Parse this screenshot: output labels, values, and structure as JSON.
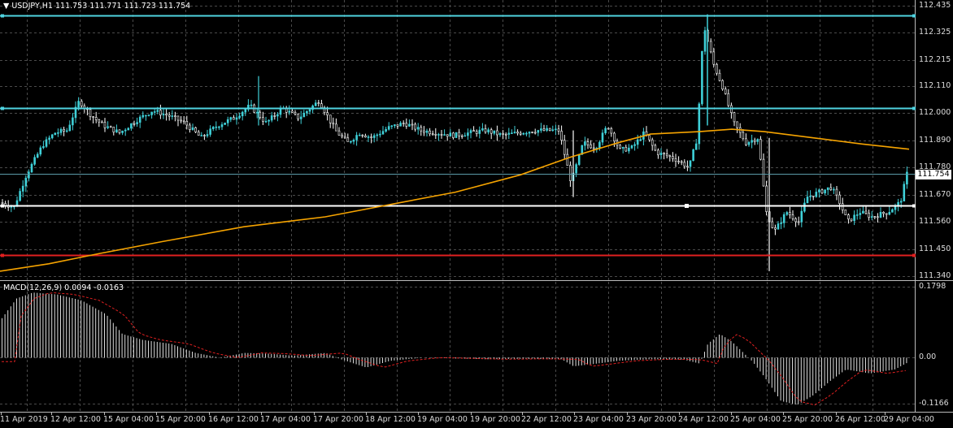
{
  "chart_data": [
    {
      "type": "candlestick",
      "symbol": "USDJPY,H1",
      "ohlc": {
        "open": 111.753,
        "high": 111.771,
        "low": 111.723,
        "close": 111.754
      },
      "header_text": "USDJPY,H1  111.753 111.771 111.723 111.754",
      "y_ticks": [
        "112.435",
        "112.325",
        "112.215",
        "112.110",
        "112.000",
        "111.890",
        "111.780",
        "111.670",
        "111.560",
        "111.450",
        "111.340"
      ],
      "ylim": [
        111.34,
        112.435
      ],
      "bid_label": "111.754",
      "horizontal_lines": [
        {
          "price": 112.395,
          "color": "#4fd3e0"
        },
        {
          "price": 112.02,
          "color": "#4fd3e0"
        },
        {
          "price": 111.626,
          "color": "#ffffff"
        },
        {
          "price": 111.425,
          "color": "#e02020"
        }
      ],
      "moving_average_color": "#f5a300",
      "candle_color": "#ffffff",
      "bull_color": "#3fd0d8",
      "grid": true
    },
    {
      "type": "histogram",
      "name": "MACD(12,26,9) 0.0094 -0.0163",
      "y_ticks": [
        "0.1798",
        "0.00",
        "-0.1166"
      ],
      "ylim": [
        -0.1166,
        0.1798
      ],
      "signal_color": "#e02020",
      "grid": true
    }
  ],
  "time_axis": [
    "11 Apr 2019",
    "12 Apr 12:00",
    "15 Apr 04:00",
    "15 Apr 20:00",
    "16 Apr 12:00",
    "17 Apr 04:00",
    "17 Apr 20:00",
    "18 Apr 12:00",
    "19 Apr 04:00",
    "19 Apr 20:00",
    "22 Apr 12:00",
    "23 Apr 04:00",
    "23 Apr 20:00",
    "24 Apr 12:00",
    "25 Apr 04:00",
    "25 Apr 20:00",
    "26 Apr 12:00",
    "29 Apr 04:00"
  ],
  "menu_icon": "triangle-down-icon"
}
